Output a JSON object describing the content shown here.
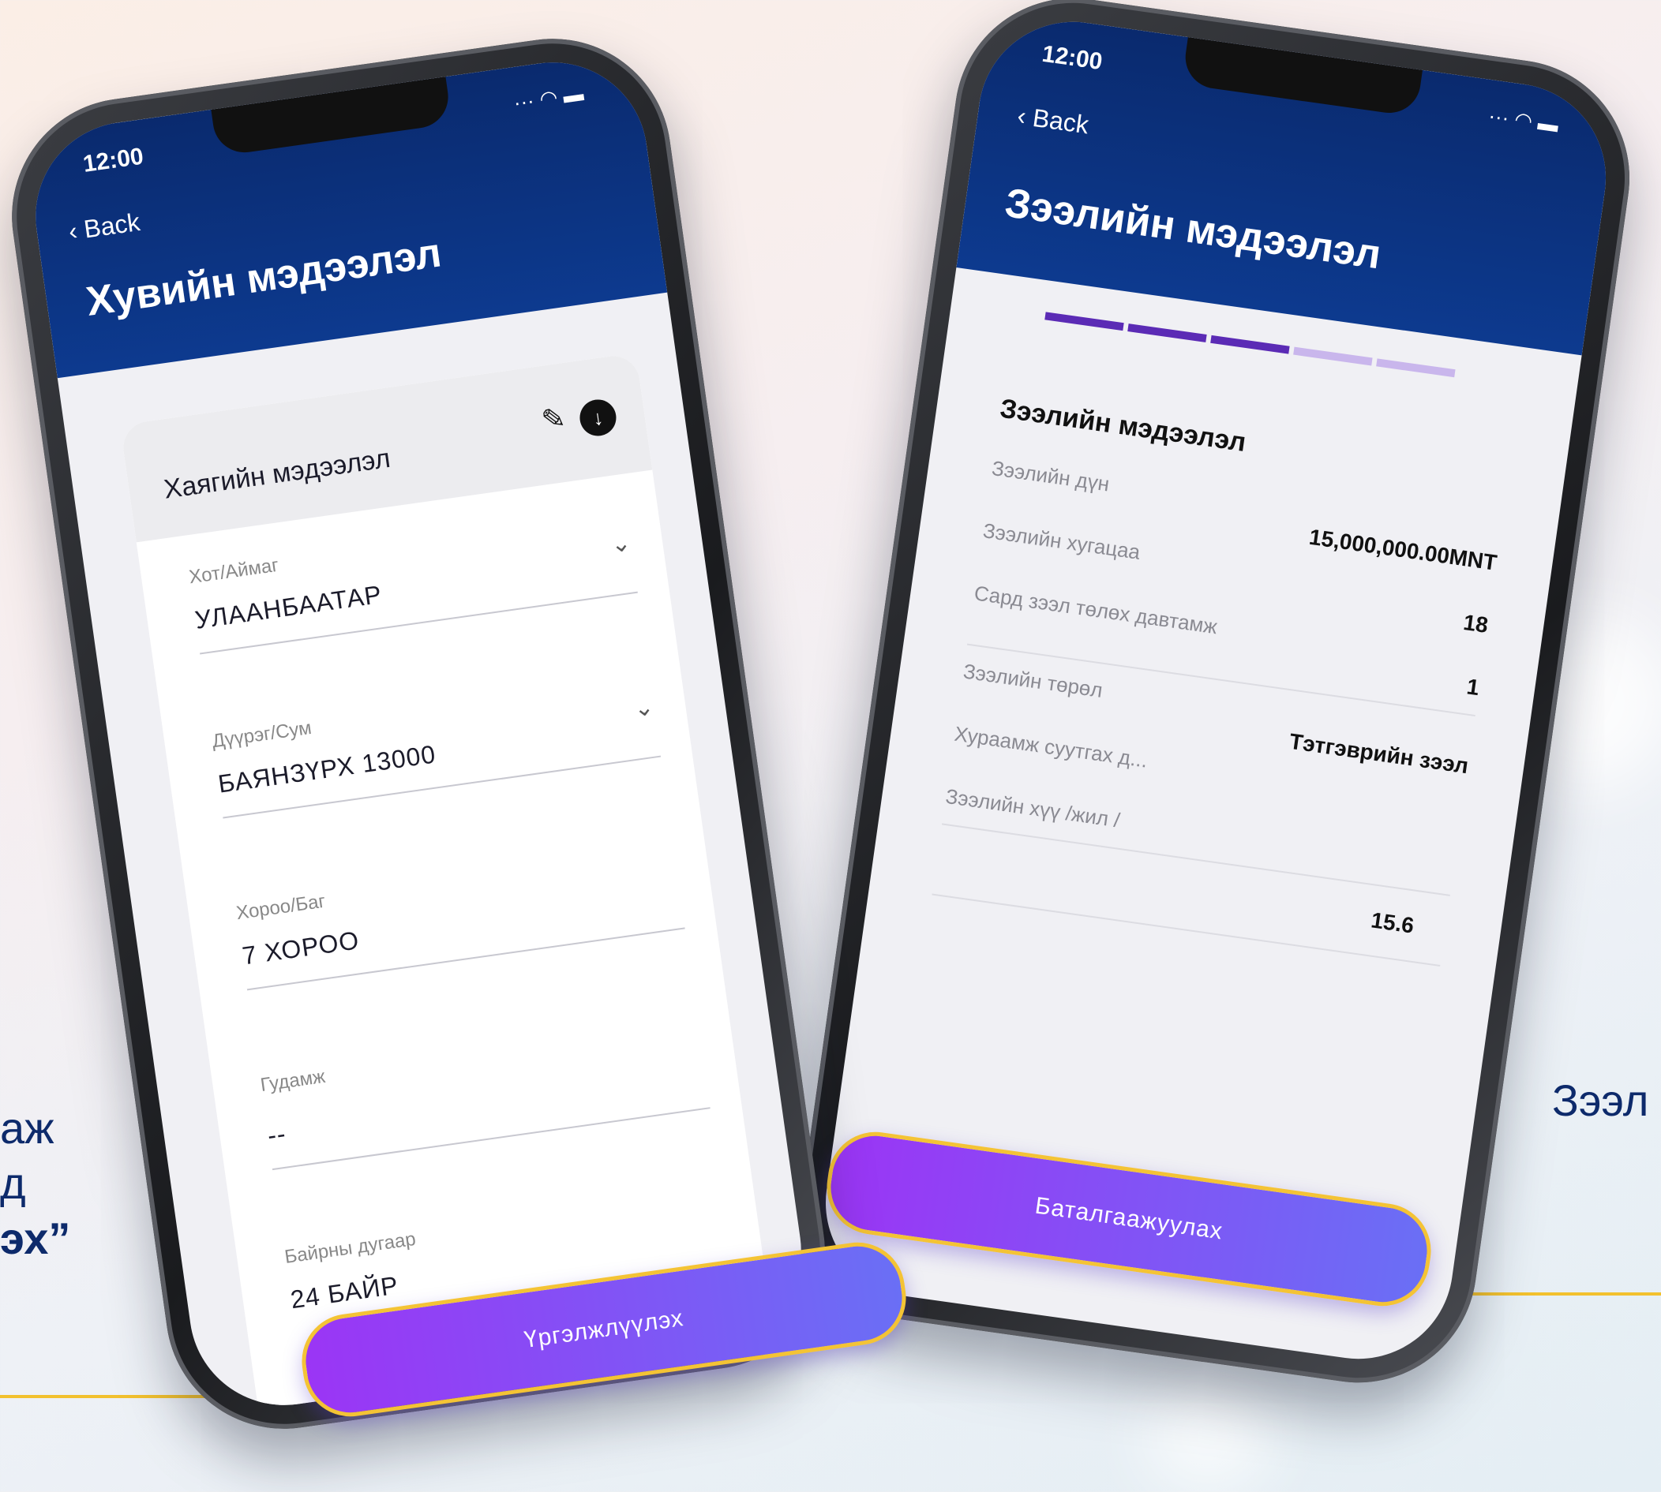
{
  "left_caption": {
    "line1": "аж",
    "line2": "д",
    "line3": "эх”"
  },
  "right_caption": "Зээл",
  "phone_left": {
    "time": "12:00",
    "back_label": "Back",
    "title": "Хувийн мэдээлэл",
    "card_title": "Хаягийн мэдээлэл",
    "fields": [
      {
        "label": "Хот/Аймаг",
        "value": "УЛААНБААТАР"
      },
      {
        "label": "Дүүрэг/Сум",
        "value": "БАЯНЗҮРХ 13000"
      },
      {
        "label": "Хороо/Баг",
        "value": "7 ХОРОО"
      },
      {
        "label": "Гудамж",
        "value": "--"
      },
      {
        "label": "Байрны дугаар",
        "value": "24 БАЙР"
      }
    ],
    "cta_label": "Үргэлжлүүлэх"
  },
  "phone_right": {
    "time": "12:00",
    "back_label": "Back",
    "title": "Зээлийн мэдээлэл",
    "section_title": "Зээлийн мэдээлэл",
    "progress": {
      "steps": 5,
      "completed": 3,
      "active_color": "#5b2bb5",
      "inactive_color": "#c9b6ec"
    },
    "rows": [
      {
        "label": "Зээлийн дүн",
        "value": "15,000,000.00MNT"
      },
      {
        "label": "Зээлийн хугацаа",
        "value": "18"
      },
      {
        "label": "Сард зээл төлөх давтамж",
        "value": "1"
      },
      {
        "label": "Зээлийн төрөл",
        "value": "Тэтгэврийн зээл"
      },
      {
        "label": "Хураамж суутгах д...",
        "value": ""
      },
      {
        "label": "Зээлийн хүү /жил /",
        "value": "15.6"
      }
    ],
    "cta_label": "Баталгаажуулах"
  },
  "colors": {
    "header": "#0a2a6e",
    "cta_start": "#9b35f5",
    "cta_end": "#6a6ff5",
    "accent_border": "#f4c335"
  }
}
